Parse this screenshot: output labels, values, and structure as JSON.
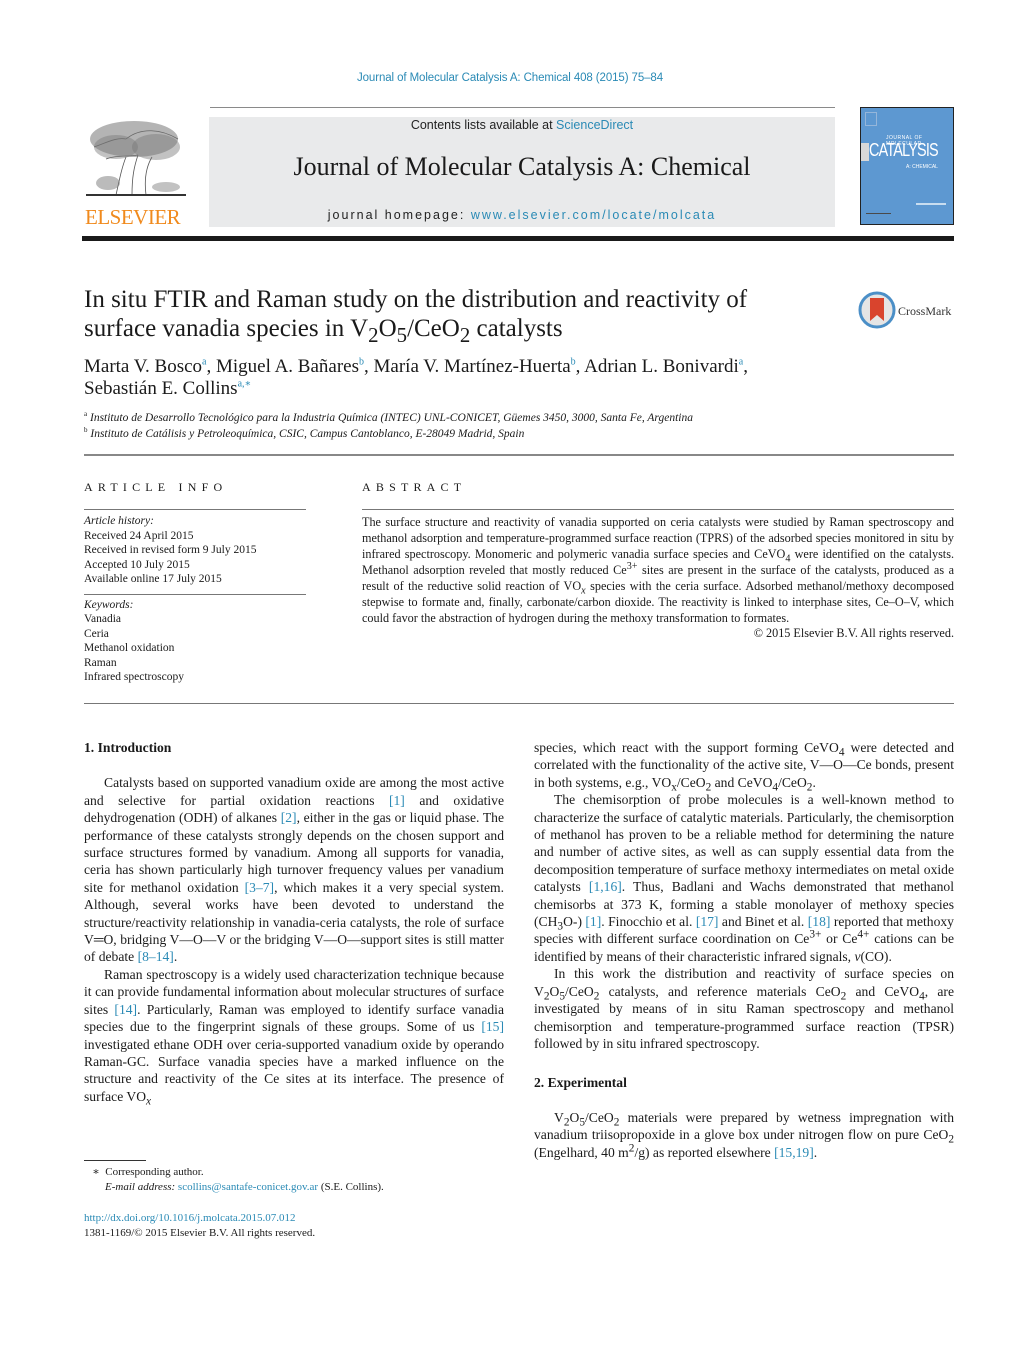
{
  "header": {
    "journal_reference": "Journal of Molecular Catalysis A: Chemical 408 (2015) 75–84",
    "contents_prefix": "Contents lists available at ",
    "contents_link": "ScienceDirect",
    "journal_title": "Journal of Molecular Catalysis A: Chemical",
    "homepage_prefix": "journal homepage: ",
    "homepage_link": "www.elsevier.com/locate/molcata",
    "publisher_logo_text": "ELSEVIER",
    "cover": {
      "top_text": "JOURNAL OF MOLECULAR",
      "big_text": "CATALYSIS",
      "sub_text": "A: CHEMICAL",
      "color": "#5d98d1"
    },
    "brand_color": "#f08a1d",
    "link_color": "#2a8ab5"
  },
  "article": {
    "title_line1": "In situ FTIR and Raman study on the distribution and reactivity of",
    "title_line2_prefix": "surface vanadia species in V",
    "crossmark_label": "CrossMark",
    "authors": [
      {
        "name": "Marta V. Bosco",
        "aff": "a"
      },
      {
        "name": "Miguel A. Bañares",
        "aff": "b"
      },
      {
        "name": "María V. Martínez-Huerta",
        "aff": "b"
      },
      {
        "name": "Adrian L. Bonivardi",
        "aff": "a"
      },
      {
        "name": "Sebastián E. Collins",
        "aff": "a,∗"
      }
    ],
    "affiliations": [
      {
        "mark": "a",
        "text": "Instituto de Desarrollo Tecnológico para la Industria Química (INTEC) UNL-CONICET, Güemes 3450, 3000, Santa Fe, Argentina"
      },
      {
        "mark": "b",
        "text": "Instituto de Catálisis y Petroleoquímica, CSIC, Campus Cantoblanco, E-28049 Madrid, Spain"
      }
    ]
  },
  "article_info": {
    "heading": "ARTICLE INFO",
    "history_label": "Article history:",
    "history": [
      "Received 24 April 2015",
      "Received in revised form 9 July 2015",
      "Accepted 10 July 2015",
      "Available online 17 July 2015"
    ],
    "keywords_label": "Keywords:",
    "keywords": [
      "Vanadia",
      "Ceria",
      "Methanol oxidation",
      "Raman",
      "Infrared spectroscopy"
    ]
  },
  "abstract": {
    "heading": "ABSTRACT",
    "copyright": "© 2015 Elsevier B.V. All rights reserved."
  },
  "sections": {
    "intro_heading": "1.  Introduction",
    "experimental_heading": "2.  Experimental"
  },
  "footnote": {
    "star": "∗",
    "corresponding": "Corresponding author.",
    "email_label": "E-mail address:",
    "email": "scollins@santafe-conicet.gov.ar",
    "email_owner": "(S.E. Collins)."
  },
  "doi": {
    "link": "http://dx.doi.org/10.1016/j.molcata.2015.07.012",
    "issn_line": "1381-1169/© 2015 Elsevier B.V. All rights reserved."
  }
}
